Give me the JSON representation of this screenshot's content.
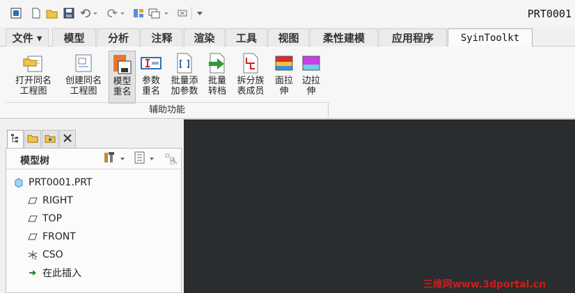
{
  "app": {
    "window_title": "PRT0001"
  },
  "quick_access": {
    "icons": [
      "window-icon",
      "new-icon",
      "open-icon",
      "save-icon",
      "undo-icon",
      "redo-icon",
      "regenerate-icon",
      "windows-icon",
      "close-icon",
      "customize-icon"
    ]
  },
  "ribbon": {
    "tabs": [
      {
        "label": "文件 ▾"
      },
      {
        "label": "模型"
      },
      {
        "label": "分析"
      },
      {
        "label": "注释"
      },
      {
        "label": "渲染"
      },
      {
        "label": "工具"
      },
      {
        "label": "视图"
      },
      {
        "label": "柔性建模"
      },
      {
        "label": "应用程序"
      },
      {
        "label": "SyinToolkt"
      }
    ],
    "active_tab": "SyinToolkt",
    "buttons": [
      {
        "label": "打开同名\n工程图"
      },
      {
        "label": "创建同名\n工程图"
      },
      {
        "label": "模型\n重名"
      },
      {
        "label": "参数\n重名"
      },
      {
        "label": "批量添\n加参数"
      },
      {
        "label": "批量\n转档"
      },
      {
        "label": "拆分族\n表成员"
      },
      {
        "label": "面拉\n伸"
      },
      {
        "label": "边拉\n伸"
      }
    ],
    "group_label": "辅助功能"
  },
  "panel": {
    "tree_title": "模型树",
    "items": [
      {
        "label": "PRT0001.PRT",
        "icon": "part-icon"
      },
      {
        "label": "RIGHT",
        "icon": "datum-plane-icon"
      },
      {
        "label": "TOP",
        "icon": "datum-plane-icon"
      },
      {
        "label": "FRONT",
        "icon": "datum-plane-icon"
      },
      {
        "label": "CSO",
        "icon": "coordinate-system-icon"
      },
      {
        "label": "在此插入",
        "icon": "insert-here-icon"
      }
    ]
  },
  "watermark": "三维网www.3dportal.cn",
  "colors": {
    "canvas": "#2a2d30",
    "watermark": "#d01c1c",
    "insert_arrow": "#1e8a2e"
  }
}
